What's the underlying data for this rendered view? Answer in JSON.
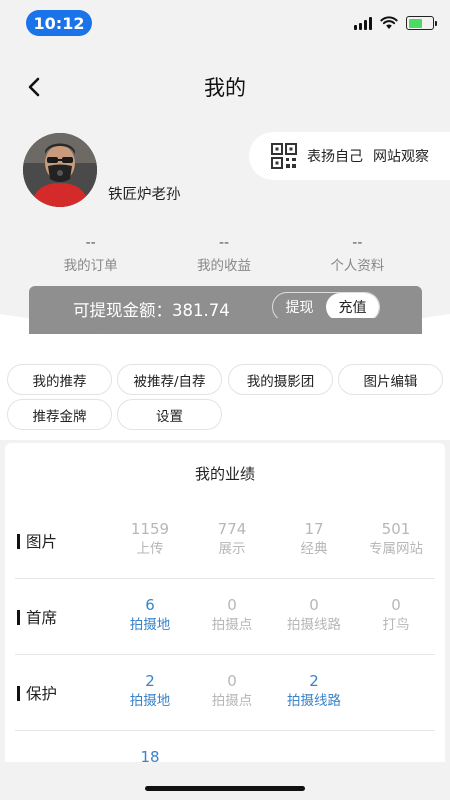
{
  "status": {
    "time": "10:12"
  },
  "header": {
    "title": "我的"
  },
  "profile": {
    "username": "铁匠炉老孙",
    "actions": [
      "表扬自己",
      "网站观察"
    ]
  },
  "stats": [
    {
      "value": "--",
      "label": "我的订单"
    },
    {
      "value": "--",
      "label": "我的收益"
    },
    {
      "value": "--",
      "label": "个人资料"
    }
  ],
  "balance": {
    "label": "可提现金额：",
    "amount": "381.74",
    "withdraw": "提现",
    "recharge": "充值"
  },
  "chips": [
    "我的推荐",
    "被推荐/自荐",
    "我的摄影团",
    "图片编辑",
    "推荐金牌",
    "设置"
  ],
  "performance": {
    "title": "我的业绩",
    "rows": [
      {
        "label": "图片",
        "metrics": [
          {
            "value": "1159",
            "label": "上传",
            "tone": "muted"
          },
          {
            "value": "774",
            "label": "展示",
            "tone": "muted"
          },
          {
            "value": "17",
            "label": "经典",
            "tone": "muted"
          },
          {
            "value": "501",
            "label": "专属网站",
            "tone": "muted"
          }
        ]
      },
      {
        "label": "首席",
        "metrics": [
          {
            "value": "6",
            "label": "拍摄地",
            "tone": "blue"
          },
          {
            "value": "0",
            "label": "拍摄点",
            "tone": "muted"
          },
          {
            "value": "0",
            "label": "拍摄线路",
            "tone": "muted"
          },
          {
            "value": "0",
            "label": "打鸟",
            "tone": "muted"
          }
        ]
      },
      {
        "label": "保护",
        "metrics": [
          {
            "value": "2",
            "label": "拍摄地",
            "tone": "blue"
          },
          {
            "value": "0",
            "label": "拍摄点",
            "tone": "muted"
          },
          {
            "value": "2",
            "label": "拍摄线路",
            "tone": "blue"
          }
        ]
      },
      {
        "label": "",
        "metrics": [
          {
            "value": "18",
            "label": "",
            "tone": "blue"
          }
        ]
      }
    ]
  },
  "colors": {
    "accent": "#1a73e8",
    "link": "#3a83c9",
    "balance_bg": "#8f8f8f"
  }
}
